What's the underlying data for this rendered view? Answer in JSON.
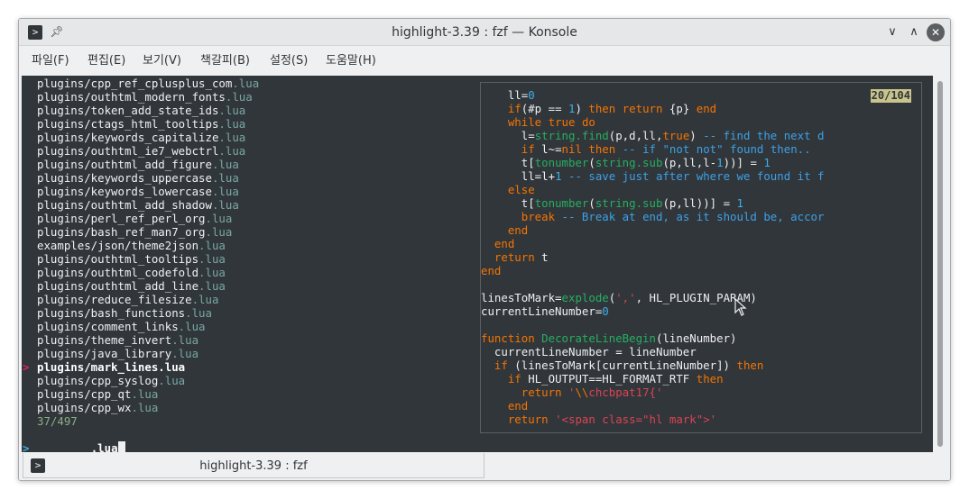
{
  "window": {
    "title": "highlight-3.39 : fzf — Konsole"
  },
  "icons": {
    "app": "terminal-icon",
    "pin": "pin-icon",
    "minimize": "chevron-down-icon",
    "maximize": "chevron-up-icon",
    "close": "close-icon"
  },
  "menubar": [
    {
      "label": "파일(F)"
    },
    {
      "label": "편집(E)"
    },
    {
      "label": "보기(V)"
    },
    {
      "label": "책갈피(B)"
    },
    {
      "label": "설정(S)"
    },
    {
      "label": "도움말(H)"
    }
  ],
  "file_list": [
    {
      "stem": "plugins/cpp_ref_cplusplus_com",
      "ext": ".lua"
    },
    {
      "stem": "plugins/outhtml_modern_fonts",
      "ext": ".lua"
    },
    {
      "stem": "plugins/token_add_state_ids",
      "ext": ".lua"
    },
    {
      "stem": "plugins/ctags_html_tooltips",
      "ext": ".lua"
    },
    {
      "stem": "plugins/keywords_capitalize",
      "ext": ".lua"
    },
    {
      "stem": "plugins/outhtml_ie7_webctrl",
      "ext": ".lua"
    },
    {
      "stem": "plugins/outhtml_add_figure",
      "ext": ".lua"
    },
    {
      "stem": "plugins/keywords_uppercase",
      "ext": ".lua"
    },
    {
      "stem": "plugins/keywords_lowercase",
      "ext": ".lua"
    },
    {
      "stem": "plugins/outhtml_add_shadow",
      "ext": ".lua"
    },
    {
      "stem": "plugins/perl_ref_perl_org",
      "ext": ".lua"
    },
    {
      "stem": "plugins/bash_ref_man7_org",
      "ext": ".lua"
    },
    {
      "stem": "examples/json/theme2json",
      "ext": ".lua"
    },
    {
      "stem": "plugins/outhtml_tooltips",
      "ext": ".lua"
    },
    {
      "stem": "plugins/outhtml_codefold",
      "ext": ".lua"
    },
    {
      "stem": "plugins/outhtml_add_line",
      "ext": ".lua"
    },
    {
      "stem": "plugins/reduce_filesize",
      "ext": ".lua"
    },
    {
      "stem": "plugins/bash_functions",
      "ext": ".lua"
    },
    {
      "stem": "plugins/comment_links",
      "ext": ".lua"
    },
    {
      "stem": "plugins/theme_invert",
      "ext": ".lua"
    },
    {
      "stem": "plugins/java_library",
      "ext": ".lua"
    },
    {
      "stem": "plugins/mark_lines.lua",
      "ext": "",
      "selected": true
    },
    {
      "stem": "plugins/cpp_syslog",
      "ext": ".lua"
    },
    {
      "stem": "plugins/cpp_qt",
      "ext": ".lua"
    },
    {
      "stem": "plugins/cpp_wx",
      "ext": ".lua"
    }
  ],
  "fzf": {
    "pointer": ">",
    "match_count": "37/497",
    "prompt": ">",
    "query": ".lua"
  },
  "preview": {
    "position": "20/104",
    "lines": [
      [
        [
          "    ll=",
          ""
        ],
        [
          "0",
          "num"
        ]
      ],
      [
        [
          "    ",
          ""
        ],
        [
          "if",
          "kw"
        ],
        [
          "(#p == ",
          ""
        ],
        [
          "1",
          "num"
        ],
        [
          ") ",
          ""
        ],
        [
          "then",
          "kw"
        ],
        [
          " ",
          ""
        ],
        [
          "return",
          "kw"
        ],
        [
          " {p} ",
          ""
        ],
        [
          "end",
          "kw"
        ]
      ],
      [
        [
          "    ",
          ""
        ],
        [
          "while",
          "kw"
        ],
        [
          " ",
          ""
        ],
        [
          "true",
          "kw"
        ],
        [
          " ",
          ""
        ],
        [
          "do",
          "kw"
        ]
      ],
      [
        [
          "      l=",
          ""
        ],
        [
          "string.find",
          "fn"
        ],
        [
          "(p,d,ll,",
          ""
        ],
        [
          "true",
          "kw"
        ],
        [
          ") ",
          ""
        ],
        [
          "-- find the next d",
          "cm"
        ]
      ],
      [
        [
          "      ",
          ""
        ],
        [
          "if",
          "kw"
        ],
        [
          " l~=",
          ""
        ],
        [
          "nil",
          "kw"
        ],
        [
          " ",
          ""
        ],
        [
          "then",
          "kw"
        ],
        [
          " ",
          ""
        ],
        [
          "-- if \"not not\" found then..",
          "cm"
        ]
      ],
      [
        [
          "      t[",
          ""
        ],
        [
          "tonumber",
          "fn"
        ],
        [
          "(",
          ""
        ],
        [
          "string.sub",
          "fn"
        ],
        [
          "(p,ll,l-",
          ""
        ],
        [
          "1",
          "num"
        ],
        [
          "))] = ",
          ""
        ],
        [
          "1",
          "num"
        ]
      ],
      [
        [
          "      ll=l+",
          ""
        ],
        [
          "1",
          "num"
        ],
        [
          " ",
          ""
        ],
        [
          "-- save just after where we found it f",
          "cm"
        ]
      ],
      [
        [
          "    ",
          ""
        ],
        [
          "else",
          "kw"
        ]
      ],
      [
        [
          "      t[",
          ""
        ],
        [
          "tonumber",
          "fn"
        ],
        [
          "(",
          ""
        ],
        [
          "string.sub",
          "fn"
        ],
        [
          "(p,ll))] = ",
          ""
        ],
        [
          "1",
          "num"
        ]
      ],
      [
        [
          "      ",
          ""
        ],
        [
          "break",
          "kw"
        ],
        [
          " ",
          ""
        ],
        [
          "-- Break at end, as it should be, accor",
          "cm"
        ]
      ],
      [
        [
          "    ",
          ""
        ],
        [
          "end",
          "kw"
        ]
      ],
      [
        [
          "  ",
          ""
        ],
        [
          "end",
          "kw"
        ]
      ],
      [
        [
          "  ",
          ""
        ],
        [
          "return",
          "kw"
        ],
        [
          " t",
          ""
        ]
      ],
      [
        [
          "",
          ""
        ],
        [
          "end",
          "kw"
        ]
      ],
      [
        [
          "",
          ""
        ]
      ],
      [
        [
          "linesToMark=",
          ""
        ],
        [
          "explode",
          "fn"
        ],
        [
          "(",
          ""
        ],
        [
          "','",
          "str"
        ],
        [
          ", HL_PLUGIN_PARAM)",
          ""
        ]
      ],
      [
        [
          "currentLineNumber=",
          ""
        ],
        [
          "0",
          "num"
        ]
      ],
      [
        [
          "",
          ""
        ]
      ],
      [
        [
          "",
          ""
        ],
        [
          "function",
          "kw"
        ],
        [
          " ",
          ""
        ],
        [
          "DecorateLineBegin",
          "fn"
        ],
        [
          "(lineNumber)",
          ""
        ]
      ],
      [
        [
          "  currentLineNumber = lineNumber",
          ""
        ]
      ],
      [
        [
          "  ",
          ""
        ],
        [
          "if",
          "kw"
        ],
        [
          " (linesToMark[currentLineNumber]) ",
          ""
        ],
        [
          "then",
          "kw"
        ]
      ],
      [
        [
          "    ",
          ""
        ],
        [
          "if",
          "kw"
        ],
        [
          " HL_OUTPUT==HL_FORMAT_RTF ",
          ""
        ],
        [
          "then",
          "kw"
        ]
      ],
      [
        [
          "      ",
          ""
        ],
        [
          "return",
          "kw"
        ],
        [
          " ",
          ""
        ],
        [
          "'",
          "str"
        ],
        [
          "\\\\",
          "stro"
        ],
        [
          "chcbpat17{",
          "str"
        ],
        [
          "'",
          "str"
        ]
      ],
      [
        [
          "    ",
          ""
        ],
        [
          "end",
          "kw"
        ]
      ],
      [
        [
          "    ",
          ""
        ],
        [
          "return",
          "kw"
        ],
        [
          " ",
          ""
        ],
        [
          "'<span class=\"hl mark\">'",
          "str"
        ]
      ]
    ]
  },
  "statusbar": {
    "tab_title": "highlight-3.39 : fzf"
  },
  "colors": {
    "terminal_bg": "#31363b",
    "pointer": "#e91e63",
    "prompt": "#3daee9",
    "extension": "#79a7a3",
    "counter": "#8cae86",
    "badge_bg": "#c8c48c"
  }
}
